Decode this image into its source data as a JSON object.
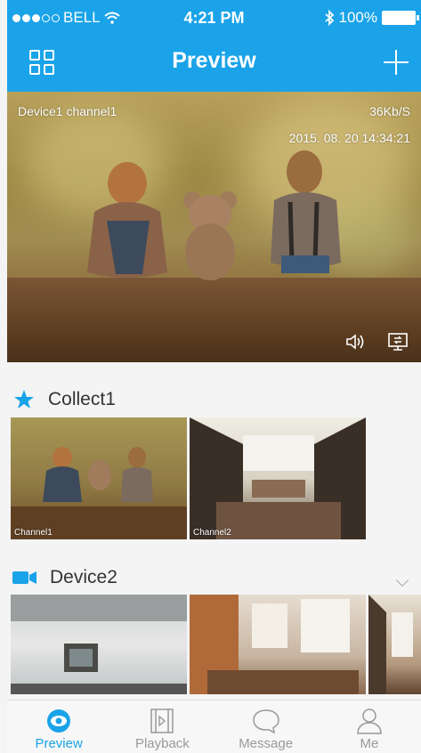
{
  "status_bar": {
    "carrier": "BELL",
    "time": "4:21 PM",
    "battery": "100%"
  },
  "header": {
    "title": "Preview"
  },
  "live_view": {
    "label": "Device1 channel1",
    "bitrate": "36Kb/S",
    "timestamp": "2015. 08. 20   14:34:21"
  },
  "sections": [
    {
      "title": "Collect1",
      "icon": "star-icon",
      "thumbs": [
        {
          "caption": "Channel1"
        },
        {
          "caption": "Channel2"
        }
      ]
    },
    {
      "title": "Device2",
      "icon": "video-camera-icon",
      "thumbs": [
        {
          "caption": ""
        },
        {
          "caption": ""
        },
        {
          "caption": ""
        }
      ]
    }
  ],
  "tabs": [
    {
      "label": "Preview",
      "icon": "eye-icon",
      "active": true
    },
    {
      "label": "Playback",
      "icon": "film-icon",
      "active": false
    },
    {
      "label": "Message",
      "icon": "chat-bubble-icon",
      "active": false
    },
    {
      "label": "Me",
      "icon": "person-icon",
      "active": false
    }
  ],
  "colors": {
    "accent": "#1aa3e8",
    "tab_inactive": "#999999"
  }
}
